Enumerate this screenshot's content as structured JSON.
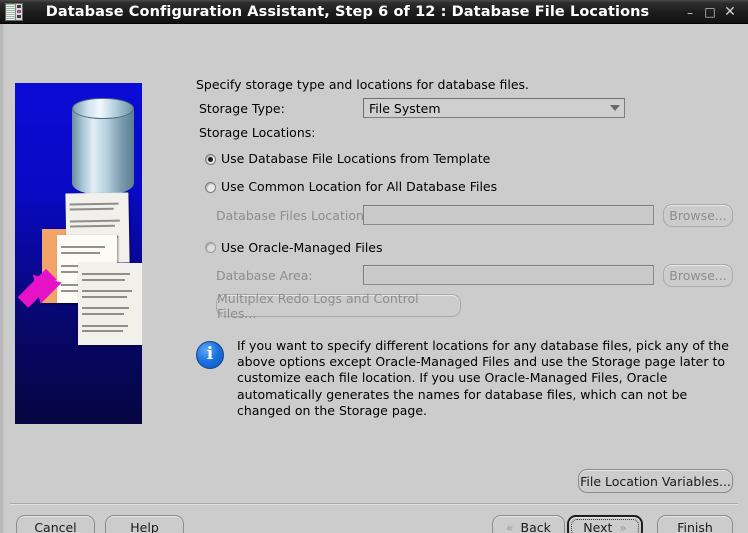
{
  "window": {
    "title": "Database Configuration Assistant, Step 6 of 12 : Database File Locations",
    "icon": "database-chip-icon",
    "minimize_label": "–",
    "maximize_label": "□",
    "close_label": "✕"
  },
  "side_graphic": {
    "name": "database-files-illustration",
    "background_color": "#0b0bd6"
  },
  "form": {
    "intro": "Specify storage type and locations for database files.",
    "storage_type_label": "Storage Type:",
    "storage_type_value": "File System",
    "storage_locations_label": "Storage Locations:",
    "options": [
      {
        "label": "Use Database File Locations from Template",
        "selected": true
      },
      {
        "label": "Use Common Location for All Database Files",
        "selected": false
      },
      {
        "label": "Use Oracle-Managed Files",
        "selected": false
      }
    ],
    "db_files_location_label": "Database Files Location:",
    "db_files_location_value": "",
    "db_area_label": "Database Area:",
    "db_area_value": "",
    "browse_label": "Browse...",
    "multiplex_label": "Multiplex Redo Logs and Control Files..."
  },
  "info": {
    "icon": "info-icon",
    "glyph": "i",
    "color": "#1a73e0",
    "text": "If you want to specify different locations for any database files, pick any of the above options except Oracle-Managed Files and use the Storage page later to customize each file location. If you use Oracle-Managed Files, Oracle automatically generates the names for database files, which can not be changed on the Storage page."
  },
  "footer": {
    "file_location_variables_label": "File Location Variables...",
    "cancel_label": "Cancel",
    "help_label": "Help",
    "back_label": "Back",
    "next_label": "Next",
    "finish_label": "Finish",
    "back_chevron": "«",
    "next_chevron": "»"
  }
}
